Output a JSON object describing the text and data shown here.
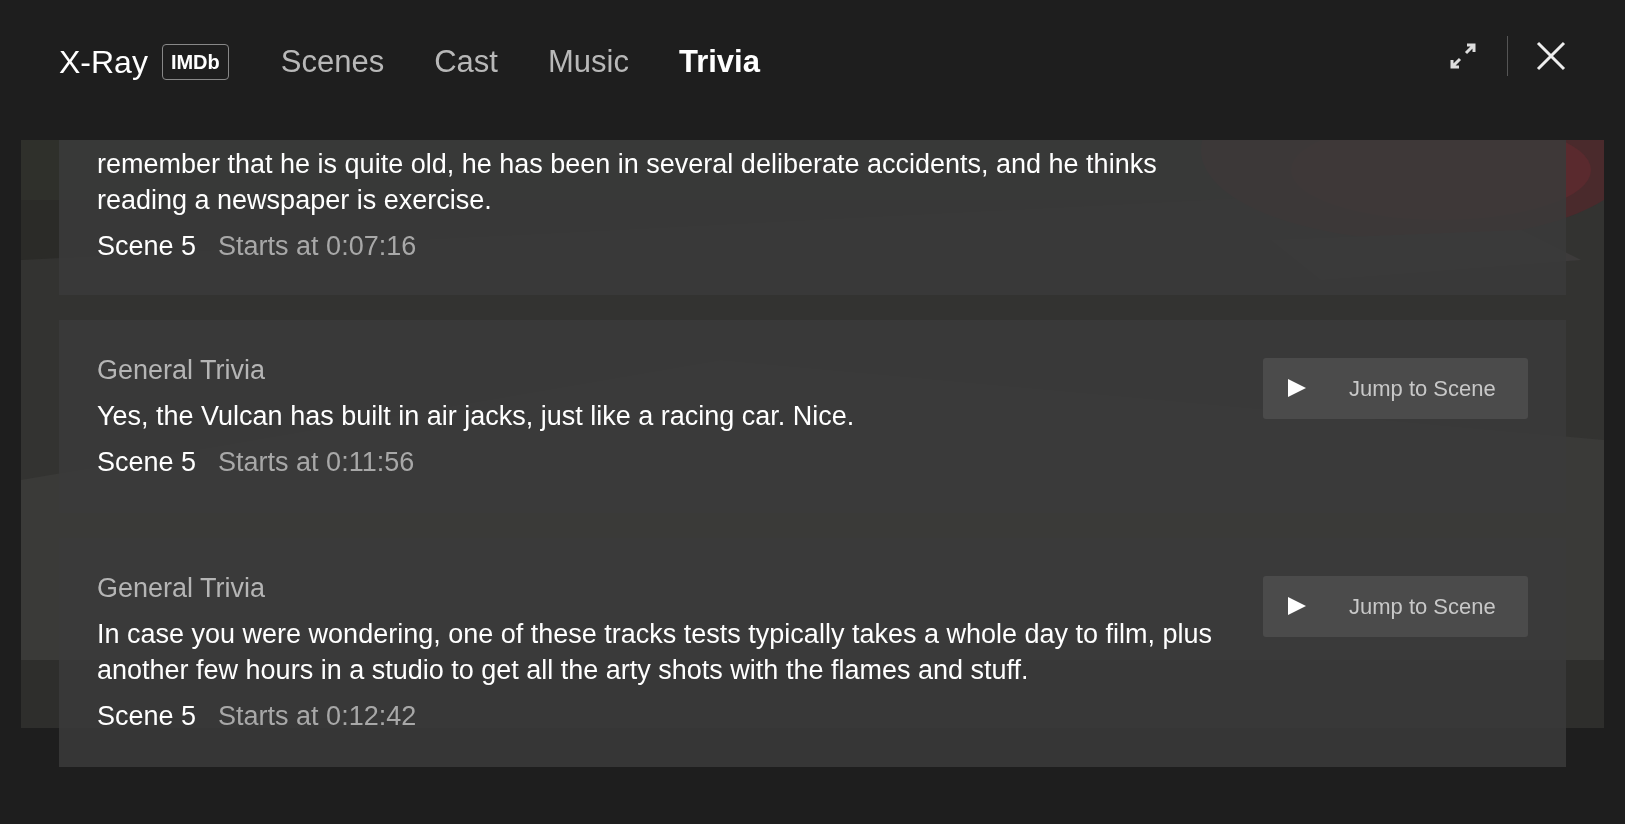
{
  "header": {
    "title": "X-Ray",
    "badge": "IMDb",
    "tabs": [
      {
        "label": "Scenes",
        "selected": false
      },
      {
        "label": "Cast",
        "selected": false
      },
      {
        "label": "Music",
        "selected": false
      },
      {
        "label": "Trivia",
        "selected": true
      }
    ]
  },
  "items": [
    {
      "text": "remember that he is quite old, he has been in several deliberate accidents, and he thinks reading a newspaper is exercise.",
      "scene": "Scene 5",
      "starts": "Starts at 0:07:16"
    },
    {
      "category": "General Trivia",
      "text": "Yes, the Vulcan has built in air jacks, just like a racing car. Nice.",
      "scene": "Scene 5",
      "starts": "Starts at 0:11:56",
      "button": "Jump to Scene"
    },
    {
      "category": "General Trivia",
      "text": "In case you were wondering, one of these tracks tests typically takes a whole day to film, plus another few hours in a studio to get all the arty shots with the flames and stuff.",
      "scene": "Scene 5",
      "starts": "Starts at 0:12:42",
      "button": "Jump to Scene"
    }
  ]
}
